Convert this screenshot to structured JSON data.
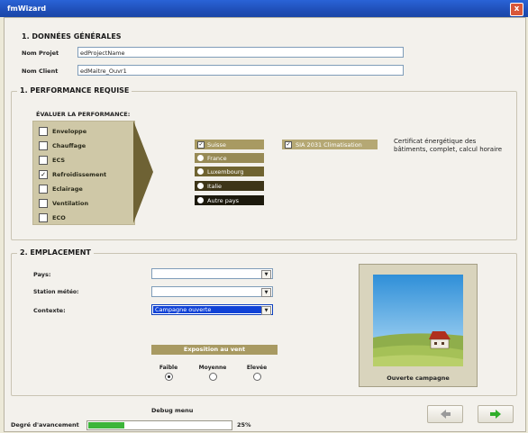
{
  "window": {
    "title": "fmWizard",
    "close_glyph": "x"
  },
  "general": {
    "title": "1.  DONNÉES GÉNÉRALES",
    "project_label": "Nom Projet",
    "project_value": "edProjectName",
    "client_label": "Nom Client",
    "client_value": "edMaitre_Ouvr1"
  },
  "performance": {
    "title": "1.  PERFORMANCE REQUISE",
    "eval_label": "ÉVALUER LA PERFORMANCE:",
    "items": [
      {
        "label": "Enveloppe",
        "checked": false
      },
      {
        "label": "Chauffage",
        "checked": false
      },
      {
        "label": "ECS",
        "checked": false
      },
      {
        "label": "Refroidissement",
        "checked": true
      },
      {
        "label": "Eclairage",
        "checked": false
      },
      {
        "label": "Ventilation",
        "checked": false
      },
      {
        "label": "ECO",
        "checked": false
      }
    ],
    "countries": [
      {
        "label": "Suisse",
        "selected": true,
        "color": "#a89a62"
      },
      {
        "label": "France",
        "selected": false,
        "color": "#978a55"
      },
      {
        "label": "Luxembourg",
        "selected": false,
        "color": "#6f6330"
      },
      {
        "label": "Italie",
        "selected": false,
        "color": "#3d3518"
      },
      {
        "label": "Autre pays",
        "selected": false,
        "color": "#1c190c"
      }
    ],
    "norm": {
      "label": "SIA 2031 Climatisation",
      "checked": true
    },
    "description": "Certificat énergétique des bâtiments, complet, calcul horaire"
  },
  "location": {
    "title": "2.  EMPLACEMENT",
    "pays_label": "Pays:",
    "pays_value": "",
    "station_label": "Station météo:",
    "station_value": "",
    "contexte_label": "Contexte:",
    "contexte_value": "Campagne ouverte",
    "exposure_title": "Exposition au vent",
    "exposure_options": [
      {
        "label": "Faible",
        "selected": true
      },
      {
        "label": "Moyenne",
        "selected": false
      },
      {
        "label": "Elevée",
        "selected": false
      }
    ],
    "image_caption": "Ouverte campagne"
  },
  "footer": {
    "debug_label": "Debug menu",
    "progress_label": "Degré d'avancement",
    "progress_fraction": 0.25,
    "progress_text": "25%",
    "accent_green": "#3db53a"
  }
}
